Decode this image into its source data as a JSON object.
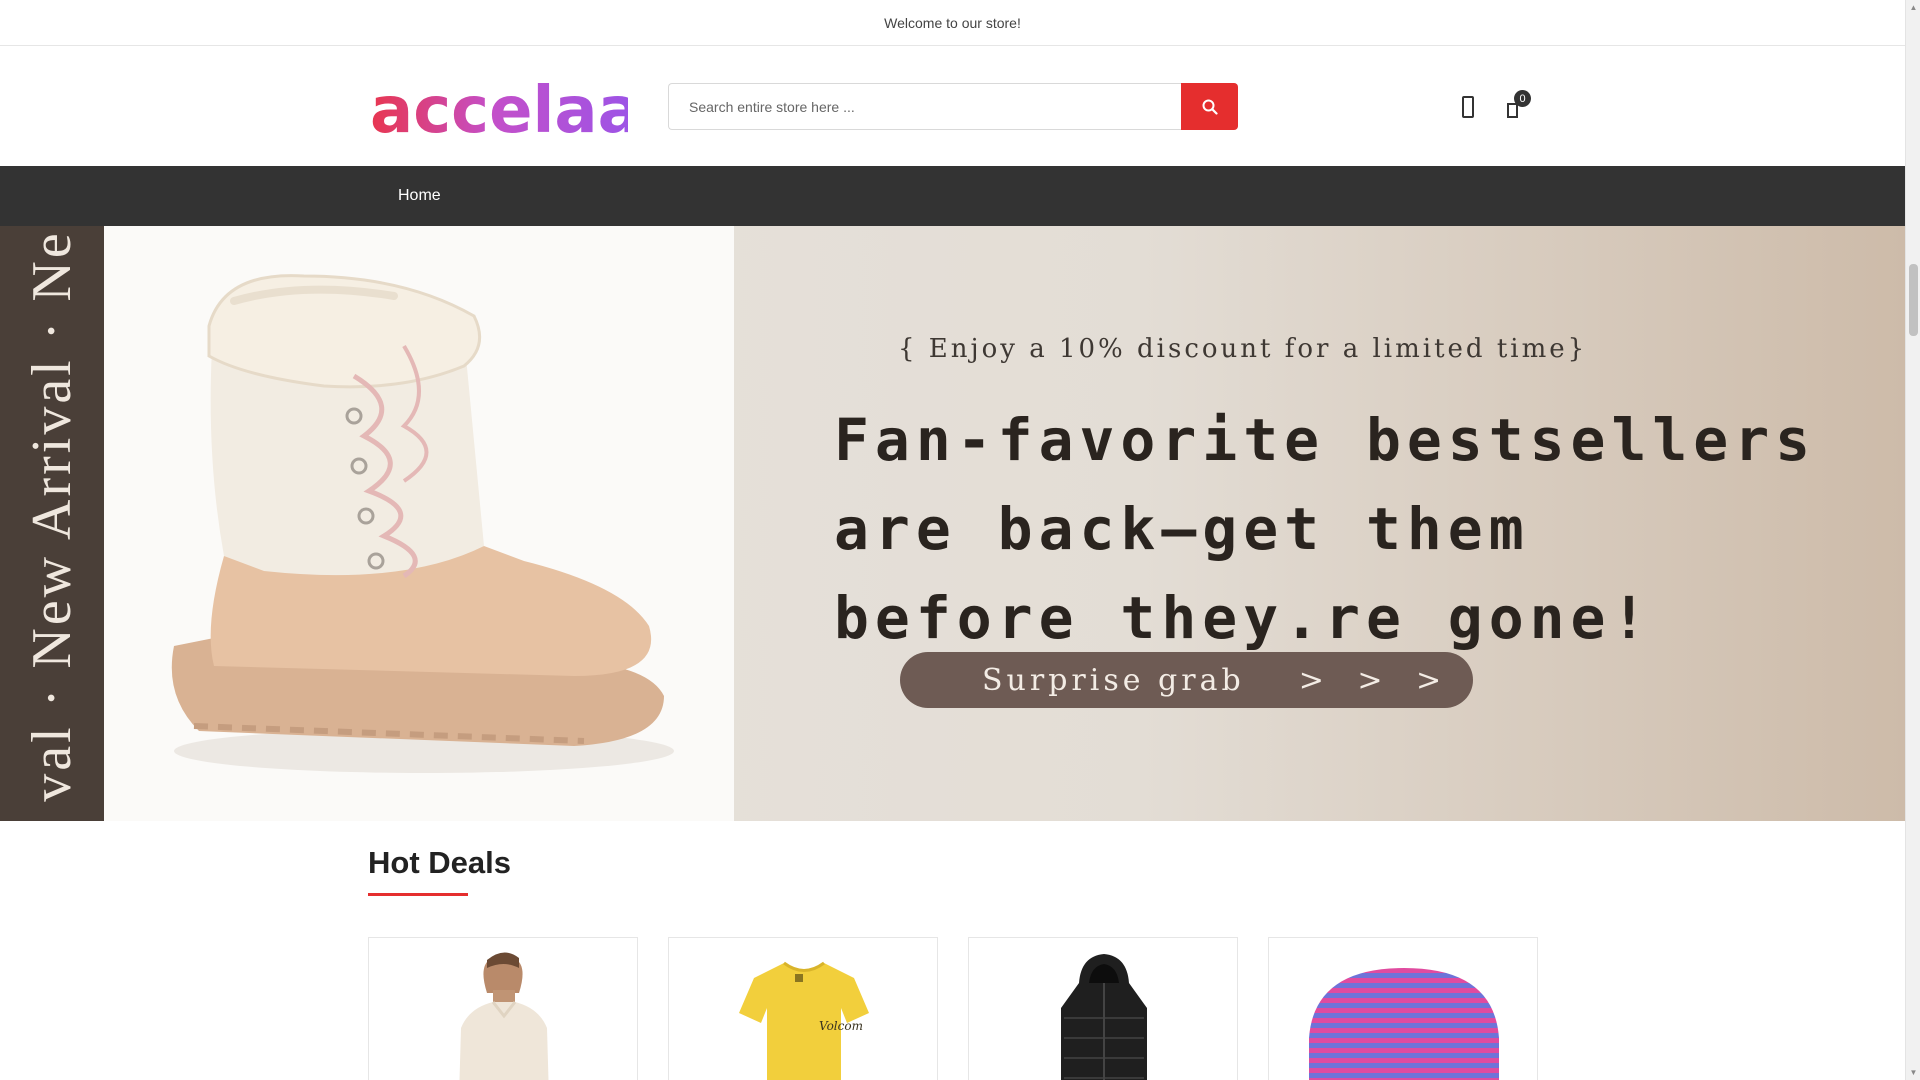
{
  "topbar": {
    "welcome": "Welcome to our store!"
  },
  "header": {
    "logo_text": "accelaa",
    "search": {
      "placeholder": "Search entire store here ...",
      "value": ""
    },
    "cart_count": "0",
    "icons": {
      "search": "search-icon",
      "user": "user-icon",
      "cart": "cart-icon"
    }
  },
  "nav": {
    "items": [
      {
        "label": "Home"
      }
    ]
  },
  "banner": {
    "side_text": "val · New Arrival · Ne",
    "subtitle": "{ Enjoy a 10% discount for a limited time}",
    "headline_lines": [
      "Fan-favorite bestsellers",
      "are back—get them",
      "before they.re gone!"
    ],
    "cta": "Surprise grab",
    "cta_arrows": "> > >"
  },
  "hot_deals": {
    "title": "Hot Deals",
    "products": [
      {
        "image": "cream-sweater"
      },
      {
        "image": "yellow-tshirt"
      },
      {
        "image": "black-puffer-coat"
      },
      {
        "image": "striped-beanie"
      }
    ]
  },
  "colors": {
    "accent": "#e52e2e",
    "nav_bg": "#333333",
    "cta_bg": "#6e5b54"
  }
}
